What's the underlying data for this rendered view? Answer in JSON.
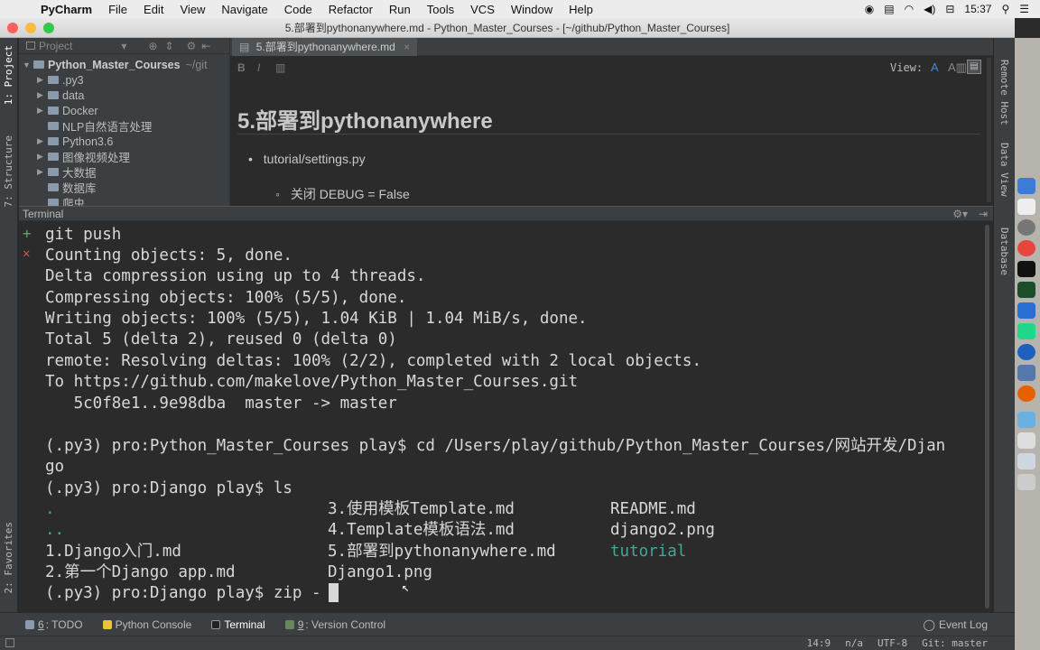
{
  "menubar": {
    "app_name": "PyCharm",
    "items": [
      "File",
      "Edit",
      "View",
      "Navigate",
      "Code",
      "Refactor",
      "Run",
      "Tools",
      "VCS",
      "Window",
      "Help"
    ],
    "clock": "15:37"
  },
  "window": {
    "title": "5.部署到pythonanywhere.md - Python_Master_Courses - [~/github/Python_Master_Courses]"
  },
  "left_strip": {
    "project_tab": "1: Project",
    "structure_tab": "7: Structure",
    "favorites_tab": "2: Favorites"
  },
  "right_strip": {
    "remote_host": "Remote Host",
    "data_view": "Data View",
    "database": "Database"
  },
  "project": {
    "view_label": "Project",
    "root_name": "Python_Master_Courses",
    "root_path": "~/git",
    "items": [
      {
        "label": ".py3",
        "arrow": "▶"
      },
      {
        "label": "data",
        "arrow": "▶"
      },
      {
        "label": "Docker",
        "arrow": "▶"
      },
      {
        "label": "NLP自然语言处理",
        "arrow": ""
      },
      {
        "label": "Python3.6",
        "arrow": "▶"
      },
      {
        "label": "图像视频处理",
        "arrow": "▶"
      },
      {
        "label": "大数据",
        "arrow": "▶"
      },
      {
        "label": "数据库",
        "arrow": ""
      },
      {
        "label": "爬虫",
        "arrow": ""
      }
    ]
  },
  "editor": {
    "tab_label": "5.部署到pythonanywhere.md",
    "view_label": "View:",
    "toolbar_bold": "B",
    "toolbar_italic": "I",
    "heading": "5.部署到pythonanywhere",
    "bullet1": "tutorial/settings.py",
    "bullet2": "关闭 DEBUG = False"
  },
  "terminal": {
    "header": "Terminal",
    "gutter_plus": "+",
    "gutter_close": "✕",
    "lines": [
      "git push",
      "Counting objects: 5, done.",
      "Delta compression using up to 4 threads.",
      "Compressing objects: 100% (5/5), done.",
      "Writing objects: 100% (5/5), 1.04 KiB | 1.04 MiB/s, done.",
      "Total 5 (delta 2), reused 0 (delta 0)",
      "remote: Resolving deltas: 100% (2/2), completed with 2 local objects.",
      "To https://github.com/makelove/Python_Master_Courses.git",
      "   5c0f8e1..9e98dba  master -> master",
      "",
      "(.py3) pro:Python_Master_Courses play$ cd /Users/play/github/Python_Master_Courses/网站开发/Djan",
      "go",
      "(.py3) pro:Django play$ ls"
    ],
    "ls_col1": [
      ".",
      "..",
      "1.Django入门.md",
      "2.第一个Django app.md"
    ],
    "ls_col2": [
      "3.使用模板Template.md",
      "4.Template模板语法.md",
      "5.部署到pythonanywhere.md",
      "Django1.png"
    ],
    "ls_col3": [
      "README.md",
      "django2.png",
      "tutorial",
      ""
    ],
    "prompt": "(.py3) pro:Django play$ zip -"
  },
  "bottom_tabs": {
    "todo_num": "6",
    "todo": ": TODO",
    "python_console": "Python Console",
    "terminal": "Terminal",
    "vc_num": "9",
    "version_control": ": Version Control",
    "event_log": "Event Log"
  },
  "status": {
    "position": "14:9",
    "na": "n/a",
    "encoding": "UTF-8",
    "git": "Git: master"
  },
  "colors": {
    "accent_blue": "#4a88c7",
    "dir_color": "#3fa99a",
    "plus_green": "#59a869",
    "close_red": "#c75450"
  }
}
